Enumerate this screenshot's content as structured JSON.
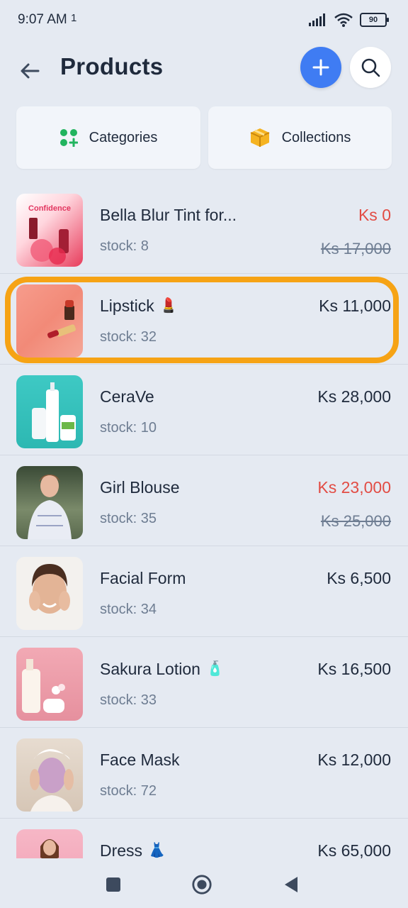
{
  "status_bar": {
    "time": "9:07 AM",
    "extra": "1",
    "battery": "90"
  },
  "header": {
    "title": "Products"
  },
  "cards": {
    "categories": "Categories",
    "collections": "Collections"
  },
  "products": [
    {
      "name": "Bella Blur Tint for...",
      "stock": "stock: 8",
      "price": "Ks 0",
      "old_price": "Ks 17,000",
      "sale": true,
      "emoji": "",
      "thumb_text": "Confidence"
    },
    {
      "name": "Lipstick",
      "stock": "stock: 32",
      "price": "Ks 11,000",
      "old_price": "",
      "sale": false,
      "emoji": "💄",
      "thumb_text": ""
    },
    {
      "name": "CeraVe",
      "stock": "stock: 10",
      "price": "Ks 28,000",
      "old_price": "",
      "sale": false,
      "emoji": "",
      "thumb_text": ""
    },
    {
      "name": "Girl Blouse",
      "stock": "stock: 35",
      "price": "Ks 23,000",
      "old_price": "Ks 25,000",
      "sale": true,
      "emoji": "",
      "thumb_text": ""
    },
    {
      "name": "Facial Form",
      "stock": "stock: 34",
      "price": "Ks 6,500",
      "old_price": "",
      "sale": false,
      "emoji": "",
      "thumb_text": ""
    },
    {
      "name": "Sakura Lotion",
      "stock": "stock: 33",
      "price": "Ks 16,500",
      "old_price": "",
      "sale": false,
      "emoji": "🧴",
      "thumb_text": ""
    },
    {
      "name": "Face Mask",
      "stock": "stock: 72",
      "price": "Ks 12,000",
      "old_price": "",
      "sale": false,
      "emoji": "",
      "thumb_text": ""
    },
    {
      "name": "Dress",
      "stock": "",
      "price": "Ks 65,000",
      "old_price": "",
      "sale": false,
      "emoji": "👗",
      "thumb_text": ""
    }
  ],
  "colors": {
    "accent": "#3f7cf3",
    "sale": "#e24c44",
    "highlight": "#f6a315",
    "background": "#e5eaf2"
  },
  "icons": {
    "back": "arrow-left-icon",
    "add": "plus-icon",
    "search": "search-icon",
    "categories": "categories-icon",
    "collections": "box-icon"
  }
}
